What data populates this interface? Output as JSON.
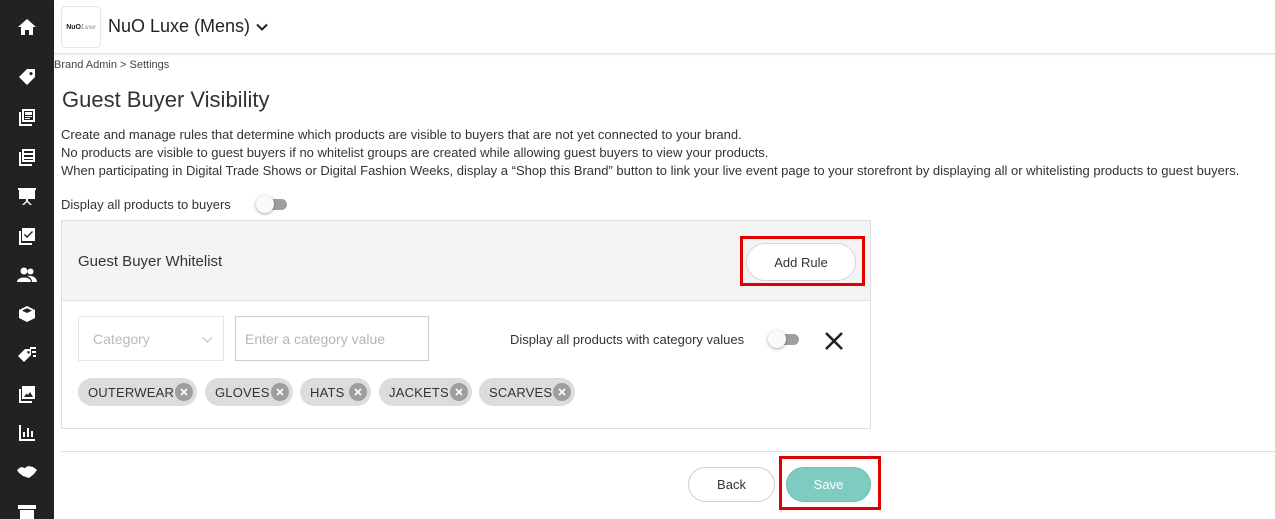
{
  "header": {
    "brand_logo_text": "NuO",
    "brand_logo_script": "Luxe",
    "brand_name": "NuO Luxe (Mens)"
  },
  "breadcrumb": "Brand Admin > Settings",
  "page": {
    "title": "Guest Buyer Visibility",
    "description_lines": [
      "Create and manage rules that determine which products are visible to buyers that are not yet connected to your brand.",
      "No products are visible to guest buyers if no whitelist groups are created while allowing guest buyers to view your products.",
      "When participating in Digital Trade Shows or Digital Fashion Weeks, display a “Shop this Brand” button to link your live event page to your storefront by displaying all or whitelisting products to guest buyers."
    ],
    "display_all_label": "Display all products to buyers",
    "display_all_enabled": false
  },
  "whitelist": {
    "title": "Guest Buyer Whitelist",
    "add_rule_label": "Add Rule",
    "rule": {
      "category_select_placeholder": "Category",
      "category_value_placeholder": "Enter a category value",
      "display_all_category_label": "Display all products with category values",
      "display_all_category_enabled": false,
      "values": [
        "OUTERWEAR",
        "GLOVES",
        "HATS",
        "JACKETS",
        "SCARVES"
      ]
    }
  },
  "footer": {
    "back_label": "Back",
    "save_label": "Save"
  },
  "colors": {
    "sidebar_bg": "#222222",
    "save_button": "#7ecbc1",
    "highlight": "#e00000",
    "chip_bg": "#dcdcdc"
  },
  "sidebar_icons": [
    "home-icon",
    "tag-icon",
    "catalog-icon",
    "order-list-icon",
    "showroom-icon",
    "checklist-icon",
    "users-icon",
    "box-icon",
    "promotions-icon",
    "images-icon",
    "analytics-icon",
    "handshake-icon",
    "storefront-icon"
  ]
}
